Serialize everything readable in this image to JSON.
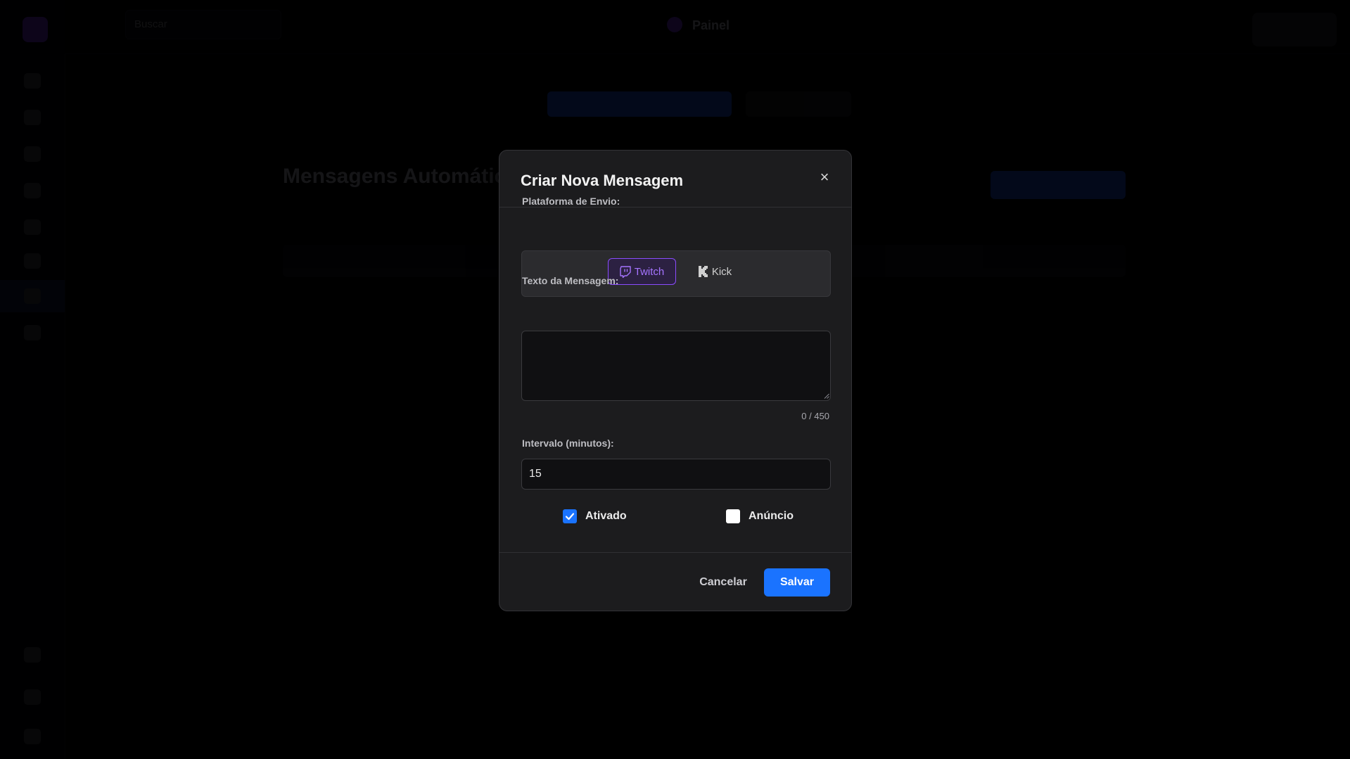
{
  "background": {
    "search_label": "Buscar",
    "brand": "Painel",
    "heading": "Mensagens Automáticas"
  },
  "modal": {
    "title": "Criar Nova Mensagem",
    "close_symbol": "×",
    "platform": {
      "label": "Plataforma de Envio:",
      "options": [
        {
          "label": "Twitch",
          "icon": "twitch-icon",
          "selected": true,
          "color": "#9146FF"
        },
        {
          "label": "Kick",
          "icon": "kick-icon",
          "selected": false
        }
      ]
    },
    "message": {
      "label": "Texto da Mensagem:",
      "value": "",
      "char_count": "0 / 450"
    },
    "interval": {
      "label": "Intervalo (minutos):",
      "value": "15"
    },
    "checkboxes": [
      {
        "label": "Ativado",
        "checked": true
      },
      {
        "label": "Anúncio",
        "checked": false
      }
    ],
    "footer": {
      "cancel_label": "Cancelar",
      "save_label": "Salvar"
    }
  },
  "colors": {
    "accent": "#1A73FF",
    "twitch": "#9146FF",
    "modal_bg": "#1C1C1E"
  }
}
